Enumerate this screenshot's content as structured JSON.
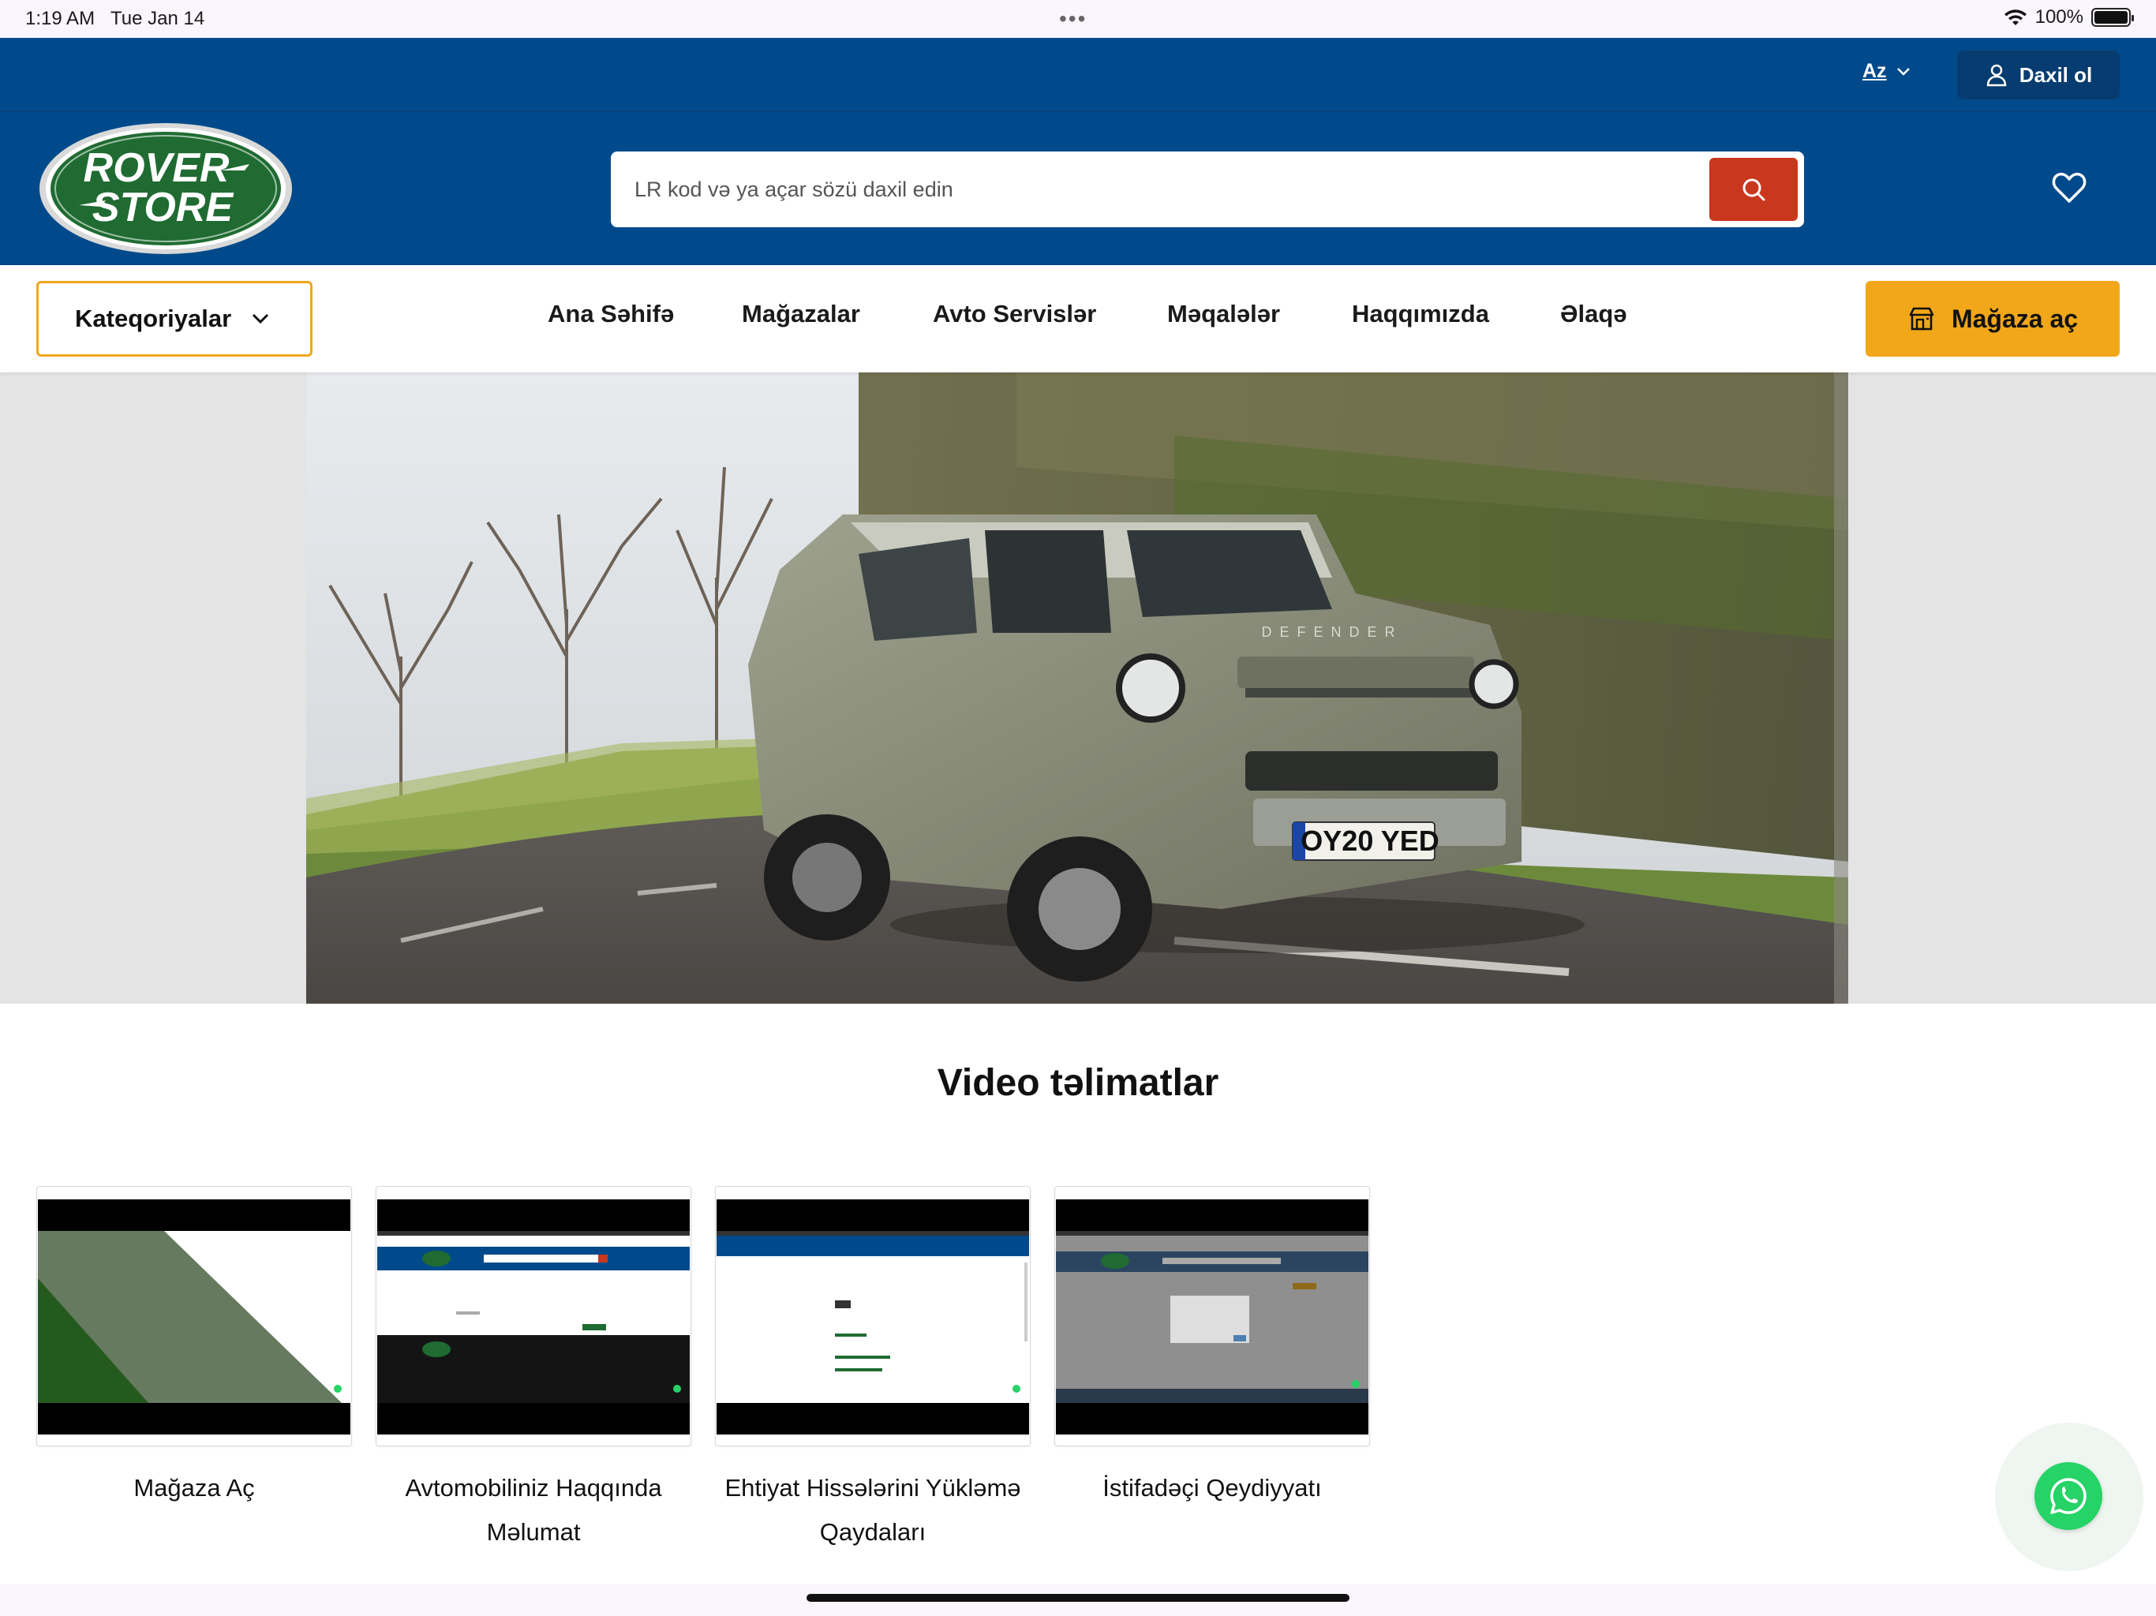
{
  "status_bar": {
    "time": "1:19 AM",
    "date": "Tue Jan 14",
    "battery": "100%"
  },
  "top_bar": {
    "language": "Az",
    "login_label": "Daxil ol"
  },
  "header": {
    "logo_text_line1": "ROVER",
    "logo_text_line2": "STORE",
    "search_placeholder": "LR kod və ya açar sözü daxil edin"
  },
  "nav": {
    "categories_label": "Kateqoriyalar",
    "items": [
      {
        "label": "Ana Səhifə"
      },
      {
        "label": "Mağazalar"
      },
      {
        "label": "Avto Servislər"
      },
      {
        "label": "Məqalələr"
      },
      {
        "label": "Haqqımızda"
      },
      {
        "label": "Əlaqə"
      }
    ],
    "open_store_label": "Mağaza aç"
  },
  "hero": {
    "plate": "OY20 YED",
    "badge": "DEFENDER"
  },
  "videos": {
    "title": "Video təlimatlar",
    "items": [
      {
        "label": "Mağaza Aç"
      },
      {
        "label": "Avtomobiliniz Haqqında Məlumat"
      },
      {
        "label": "Ehtiyat Hissələrini Yükləmə Qaydaları"
      },
      {
        "label": "İstifadəçi Qeydiyyatı"
      }
    ]
  },
  "colors": {
    "header_blue": "#004a8b",
    "accent_orange": "#f1a719",
    "search_red": "#c9371d",
    "whatsapp_green": "#25d366"
  }
}
